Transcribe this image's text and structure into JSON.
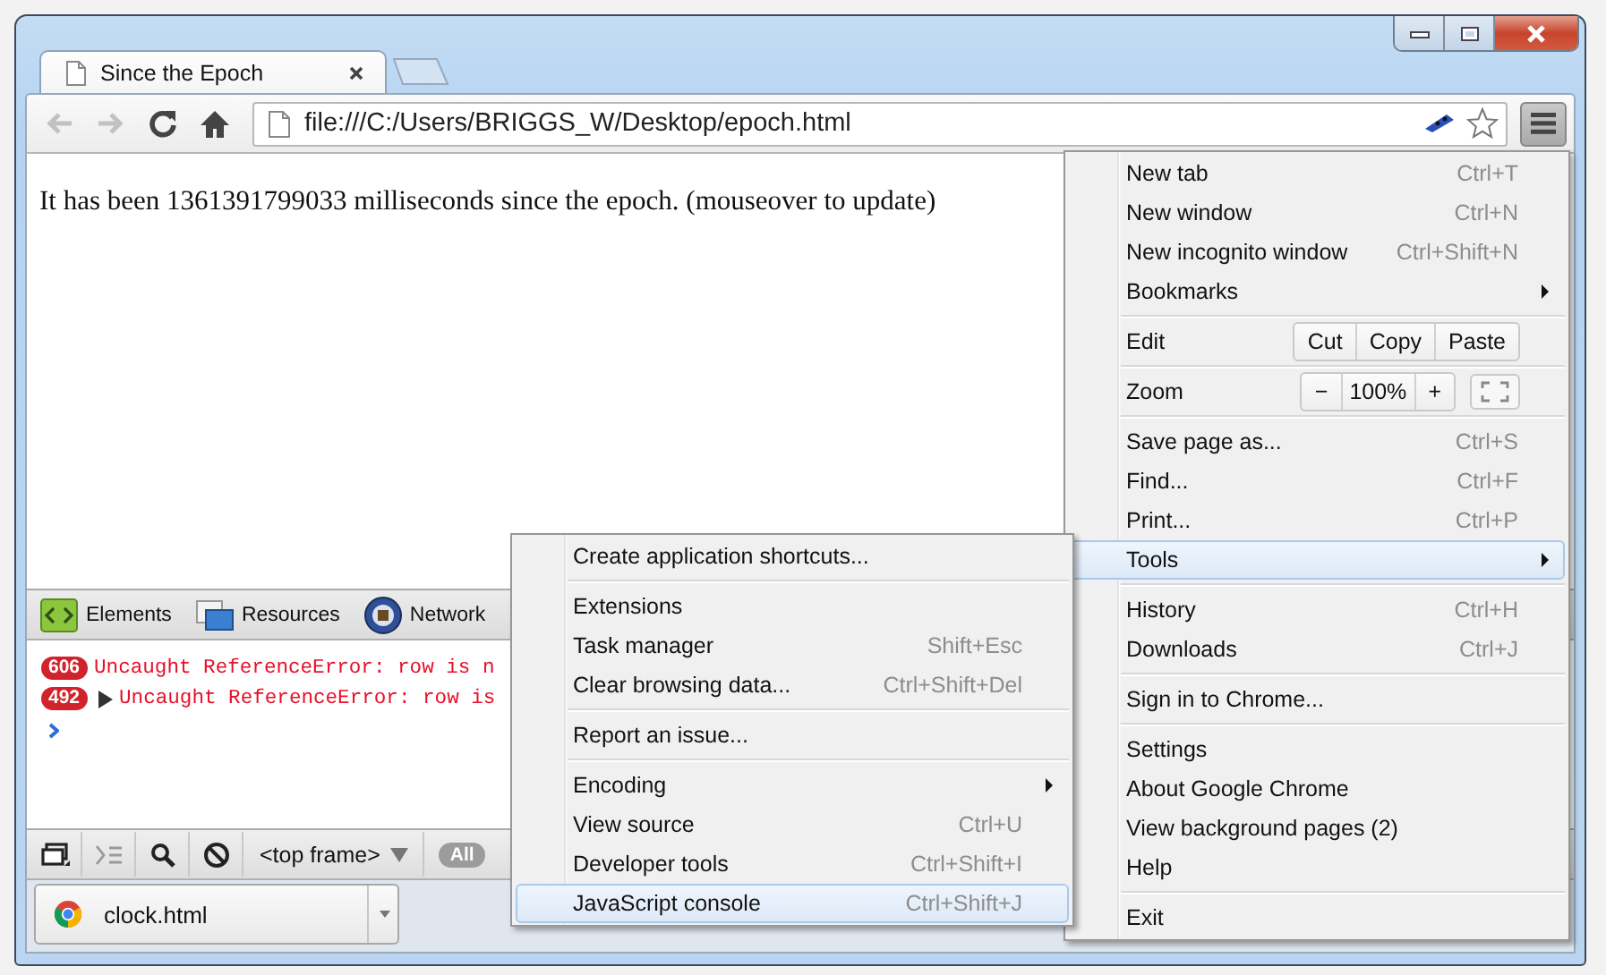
{
  "window": {
    "tabs": [
      {
        "title": "Since the Epoch",
        "selected": true
      }
    ]
  },
  "toolbar": {
    "back": {
      "disabled": true
    },
    "forward": {
      "disabled": true
    },
    "address": "file:///C:/Users/BRIGGS_W/Desktop/epoch.html"
  },
  "page": {
    "text": "It has been 1361391799033 milliseconds since the epoch. (mouseover to update)"
  },
  "devtools": {
    "panels": [
      {
        "label": "Elements"
      },
      {
        "label": "Resources"
      },
      {
        "label": "Network"
      }
    ],
    "messages": [
      {
        "count": "606",
        "text": "Uncaught ReferenceError: row is n",
        "expandable": false
      },
      {
        "count": "492",
        "text": "Uncaught ReferenceError: row is",
        "expandable": true
      }
    ],
    "context": "<top frame>",
    "filter": "All"
  },
  "downloads": [
    {
      "name": "clock.html"
    }
  ],
  "menu": {
    "items": [
      {
        "kind": "item",
        "label": "New tab",
        "shortcut": "Ctrl+T",
        "submenu": false,
        "selected": false
      },
      {
        "kind": "item",
        "label": "New window",
        "shortcut": "Ctrl+N",
        "submenu": false,
        "selected": false
      },
      {
        "kind": "item",
        "label": "New incognito window",
        "shortcut": "Ctrl+Shift+N",
        "submenu": false,
        "selected": false
      },
      {
        "kind": "item",
        "label": "Bookmarks",
        "submenu": true,
        "selected": false
      },
      {
        "kind": "separator"
      },
      {
        "kind": "edit",
        "label": "Edit",
        "buttons": [
          "Cut",
          "Copy",
          "Paste"
        ]
      },
      {
        "kind": "separator"
      },
      {
        "kind": "zoom",
        "label": "Zoom",
        "buttons": [
          "−",
          "100%",
          "+"
        ]
      },
      {
        "kind": "separator"
      },
      {
        "kind": "item",
        "label": "Save page as...",
        "shortcut": "Ctrl+S",
        "submenu": false,
        "selected": false
      },
      {
        "kind": "item",
        "label": "Find...",
        "shortcut": "Ctrl+F",
        "submenu": false,
        "selected": false
      },
      {
        "kind": "item",
        "label": "Print...",
        "shortcut": "Ctrl+P",
        "submenu": false,
        "selected": false
      },
      {
        "kind": "item",
        "label": "Tools",
        "submenu": true,
        "selected": true
      },
      {
        "kind": "separator"
      },
      {
        "kind": "item",
        "label": "History",
        "shortcut": "Ctrl+H",
        "submenu": false,
        "selected": false
      },
      {
        "kind": "item",
        "label": "Downloads",
        "shortcut": "Ctrl+J",
        "submenu": false,
        "selected": false
      },
      {
        "kind": "separator"
      },
      {
        "kind": "item",
        "label": "Sign in to Chrome...",
        "submenu": false,
        "selected": false
      },
      {
        "kind": "separator"
      },
      {
        "kind": "item",
        "label": "Settings",
        "submenu": false,
        "selected": false
      },
      {
        "kind": "item",
        "label": "About Google Chrome",
        "submenu": false,
        "selected": false
      },
      {
        "kind": "item",
        "label": "View background pages (2)",
        "submenu": false,
        "selected": false
      },
      {
        "kind": "item",
        "label": "Help",
        "submenu": false,
        "selected": false
      },
      {
        "kind": "separator"
      },
      {
        "kind": "item",
        "label": "Exit",
        "submenu": false,
        "selected": false
      }
    ]
  },
  "submenu": {
    "items": [
      {
        "kind": "item",
        "label": "Create application shortcuts...",
        "submenu": false,
        "selected": false
      },
      {
        "kind": "separator"
      },
      {
        "kind": "item",
        "label": "Extensions",
        "submenu": false,
        "selected": false
      },
      {
        "kind": "item",
        "label": "Task manager",
        "shortcut": "Shift+Esc",
        "submenu": false,
        "selected": false
      },
      {
        "kind": "item",
        "label": "Clear browsing data...",
        "shortcut": "Ctrl+Shift+Del",
        "submenu": false,
        "selected": false
      },
      {
        "kind": "separator"
      },
      {
        "kind": "item",
        "label": "Report an issue...",
        "submenu": false,
        "selected": false
      },
      {
        "kind": "separator"
      },
      {
        "kind": "item",
        "label": "Encoding",
        "submenu": true,
        "selected": false
      },
      {
        "kind": "item",
        "label": "View source",
        "shortcut": "Ctrl+U",
        "submenu": false,
        "selected": false
      },
      {
        "kind": "item",
        "label": "Developer tools",
        "shortcut": "Ctrl+Shift+I",
        "submenu": false,
        "selected": false
      },
      {
        "kind": "item",
        "label": "JavaScript console",
        "shortcut": "Ctrl+Shift+J",
        "submenu": false,
        "selected": true
      }
    ]
  }
}
